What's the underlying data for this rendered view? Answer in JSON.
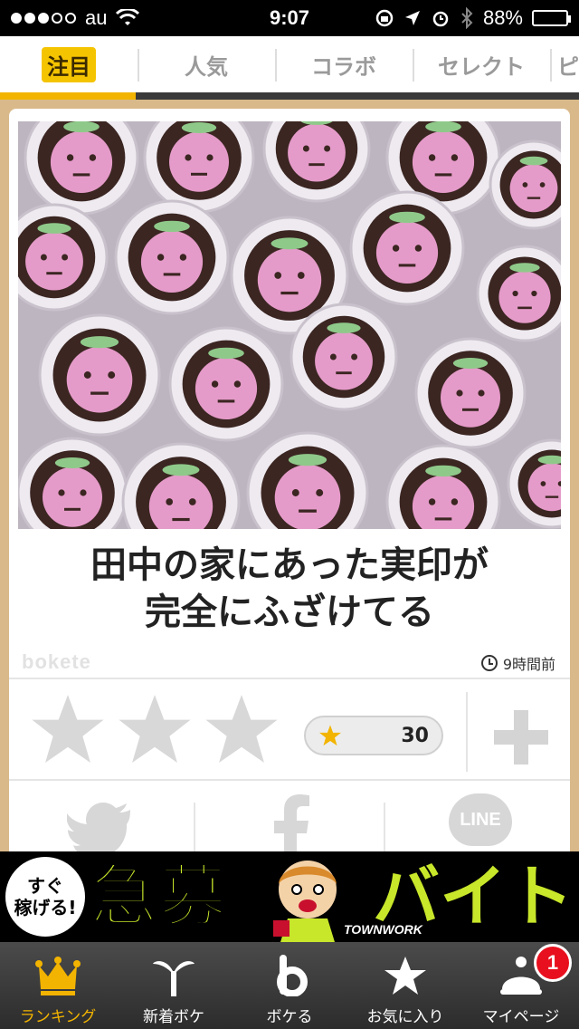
{
  "status_bar": {
    "carrier": "au",
    "time": "9:07",
    "battery": "88%",
    "battery_level": 0.88
  },
  "top_tabs": [
    {
      "label": "注目",
      "active": true
    },
    {
      "label": "人気",
      "active": false
    },
    {
      "label": "コラボ",
      "active": false
    },
    {
      "label": "セレクト",
      "active": false
    },
    {
      "label": "ピ",
      "active": false
    }
  ],
  "post": {
    "headline_line1": "田中の家にあった実印が",
    "headline_line2": "完全にふざけてる",
    "brand": "bokete",
    "time_ago": "9時間前",
    "score": "30",
    "star_rating": 0
  },
  "share": {
    "line_label": "LINE"
  },
  "ad": {
    "badge_line1": "すぐ",
    "badge_line2": "稼げる!",
    "main_text_left": "急募",
    "main_text_right": "バイト",
    "brand": "TOWNWORK"
  },
  "bottom_nav": [
    {
      "label": "ランキング",
      "icon": "crown-icon",
      "active": true
    },
    {
      "label": "新着ボケ",
      "icon": "sprout-icon",
      "active": false
    },
    {
      "label": "ボケる",
      "icon": "bokete-b-icon",
      "active": false
    },
    {
      "label": "お気に入り",
      "icon": "star-icon",
      "active": false
    },
    {
      "label": "マイページ",
      "icon": "mypage-icon",
      "active": false,
      "badge": "1"
    }
  ],
  "colors": {
    "accent": "#f2b400",
    "background": "#d9b98a",
    "ad_text": "#c8e62a",
    "badge": "#e8101e"
  }
}
